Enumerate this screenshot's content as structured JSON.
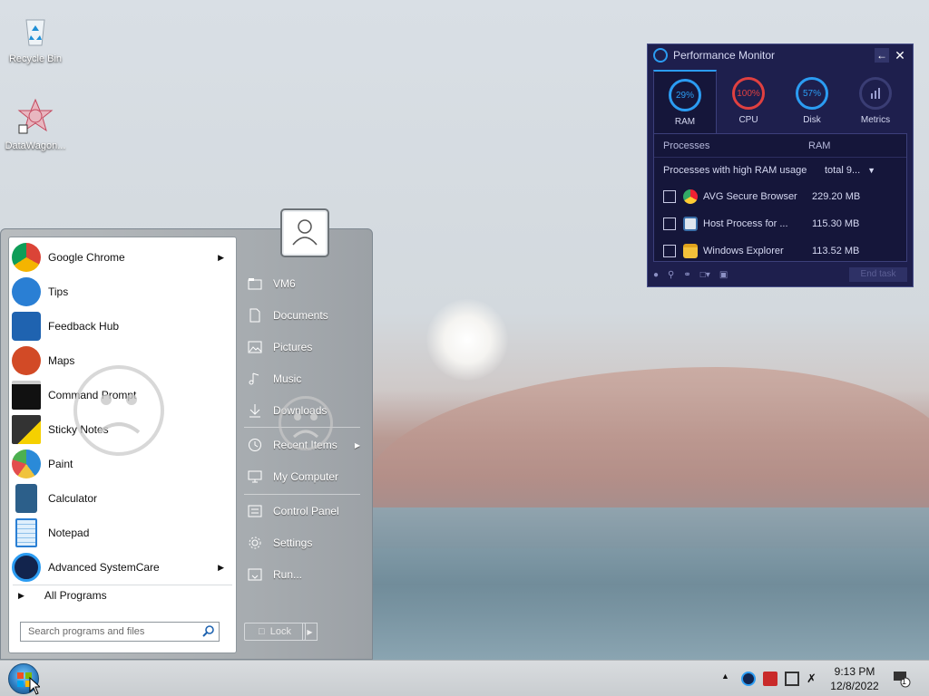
{
  "desktop": {
    "icons": [
      {
        "label": "Recycle Bin"
      },
      {
        "label": "DataWagon..."
      }
    ]
  },
  "perf_monitor": {
    "title": "Performance Monitor",
    "tabs": [
      {
        "label": "RAM",
        "value": "29%",
        "color": "#2b9cf2"
      },
      {
        "label": "CPU",
        "value": "100%",
        "color": "#e04040"
      },
      {
        "label": "Disk",
        "value": "57%",
        "color": "#2b9cf2"
      },
      {
        "label": "Metrics",
        "value": "",
        "color": "#5a5e98"
      }
    ],
    "columns": {
      "processes": "Processes",
      "ram": "RAM"
    },
    "group": {
      "label": "Processes with high RAM usage",
      "total": "total 9..."
    },
    "rows": [
      {
        "name": "AVG Secure Browser",
        "ram": "229.20 MB"
      },
      {
        "name": "Host Process for ...",
        "ram": "115.30 MB"
      },
      {
        "name": "Windows Explorer",
        "ram": "113.52 MB"
      }
    ],
    "end_task": "End task"
  },
  "start_menu": {
    "programs": [
      {
        "label": "Google Chrome",
        "submenu": true
      },
      {
        "label": "Tips"
      },
      {
        "label": "Feedback Hub"
      },
      {
        "label": "Maps"
      },
      {
        "label": "Command Prompt"
      },
      {
        "label": "Sticky Notes"
      },
      {
        "label": "Paint"
      },
      {
        "label": "Calculator"
      },
      {
        "label": "Notepad"
      },
      {
        "label": "Advanced SystemCare",
        "submenu": true
      }
    ],
    "all_programs": "All Programs",
    "search_placeholder": "Search programs and files",
    "right_items": [
      {
        "label": "VM6"
      },
      {
        "label": "Documents"
      },
      {
        "label": "Pictures"
      },
      {
        "label": "Music"
      },
      {
        "label": "Downloads"
      },
      {
        "label": "Recent Items",
        "submenu": true
      },
      {
        "label": "My Computer"
      },
      {
        "label": "Control Panel"
      },
      {
        "label": "Settings"
      },
      {
        "label": "Run..."
      }
    ],
    "lock_label": "Lock"
  },
  "taskbar": {
    "time": "9:13 PM",
    "date": "12/8/2022",
    "notification_count": "1"
  }
}
